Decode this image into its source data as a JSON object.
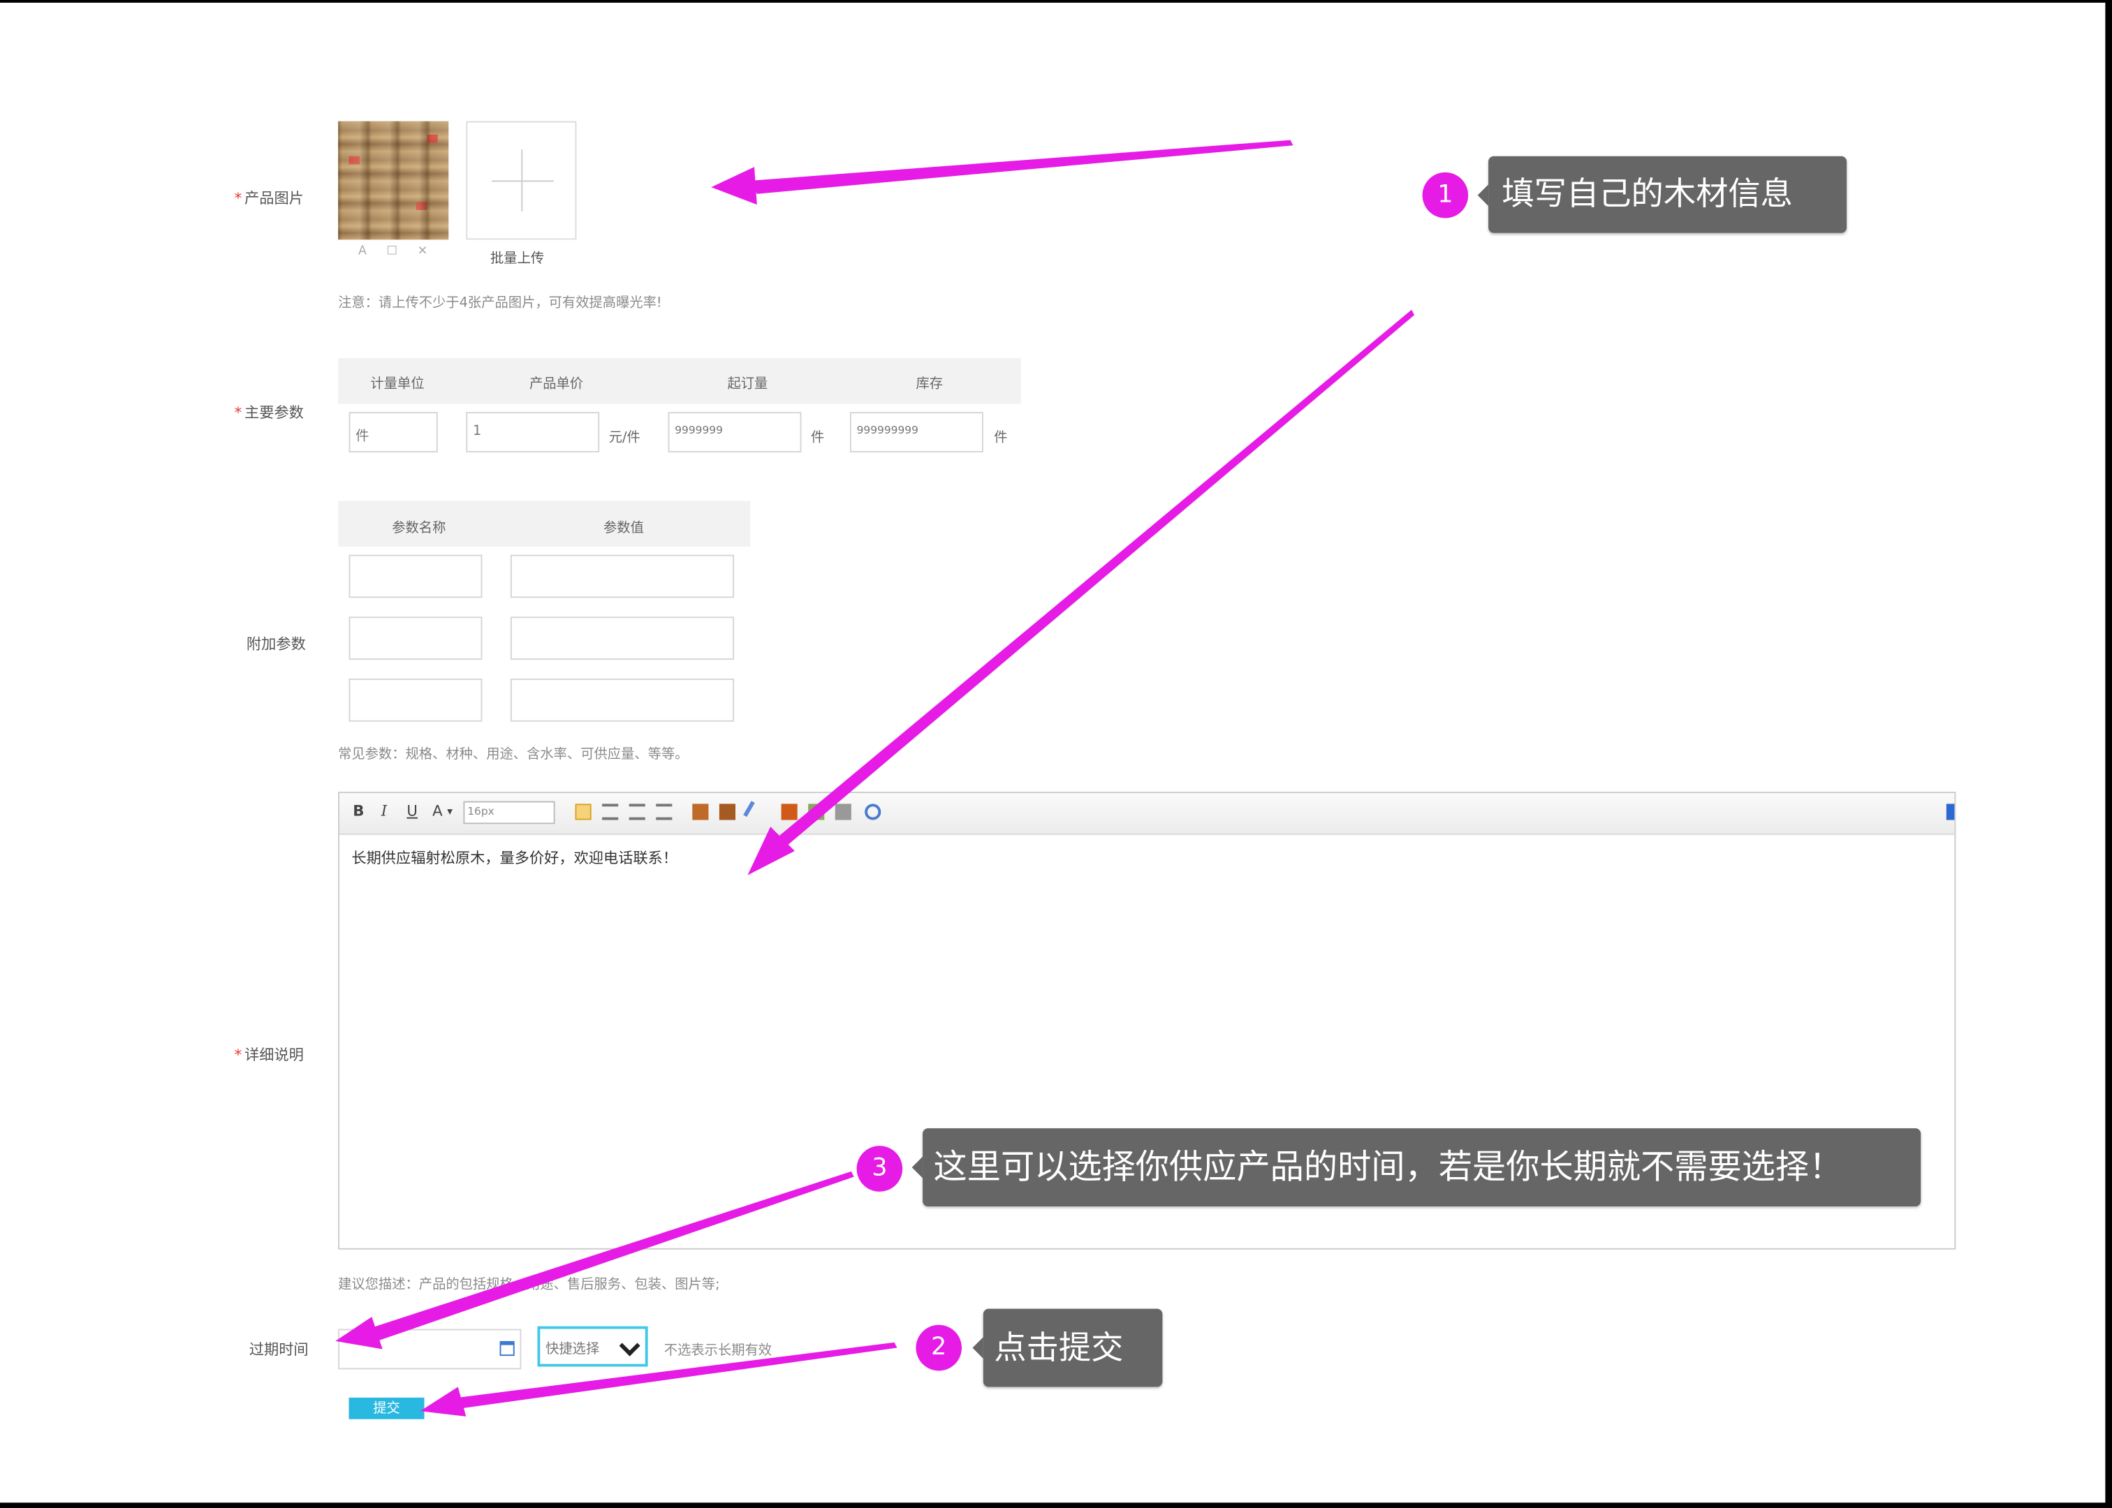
{
  "form": {
    "product_image": {
      "label": "产品图片",
      "required_mark": "*",
      "thumb_actions": "A ☐ ✕",
      "batch_upload_label": "批量上传",
      "note": "注意：请上传不少于4张产品图片，可有效提高曝光率!"
    },
    "main_params": {
      "label": "主要参数",
      "required_mark": "*",
      "headers": [
        "计量单位",
        "产品单价",
        "起订量",
        "库存"
      ],
      "unit_value": "件",
      "price_value": "1",
      "price_unit": "元/件",
      "min_order_value": "9999999",
      "min_order_unit": "件",
      "stock_value": "999999999",
      "stock_unit": "件"
    },
    "extra_params": {
      "label": "附加参数",
      "headers": [
        "参数名称",
        "参数值"
      ],
      "rows": 3,
      "hint": "常见参数：规格、材种、用途、含水率、可供应量、等等。"
    },
    "detail": {
      "label": "详细说明",
      "required_mark": "*",
      "font_size": "16px",
      "content": "长期供应辐射松原木，量多价好，欢迎电话联系！",
      "hint": "建议您描述：产品的包括规格、用途、售后服务、包装、图片等;"
    },
    "expire": {
      "label": "过期时间",
      "select_value": "快捷选择",
      "hint": "不选表示长期有效"
    },
    "submit_label": "提交"
  },
  "annotations": [
    {
      "number": "1",
      "text": "填写自己的木材信息"
    },
    {
      "number": "2",
      "text": "点击提交"
    },
    {
      "number": "3",
      "text": "这里可以选择你供应产品的时间，若是你长期就不需要选择！"
    }
  ],
  "accent_color": "#e61ce6",
  "callout_color": "#666666",
  "submit_color": "#29b8e0"
}
